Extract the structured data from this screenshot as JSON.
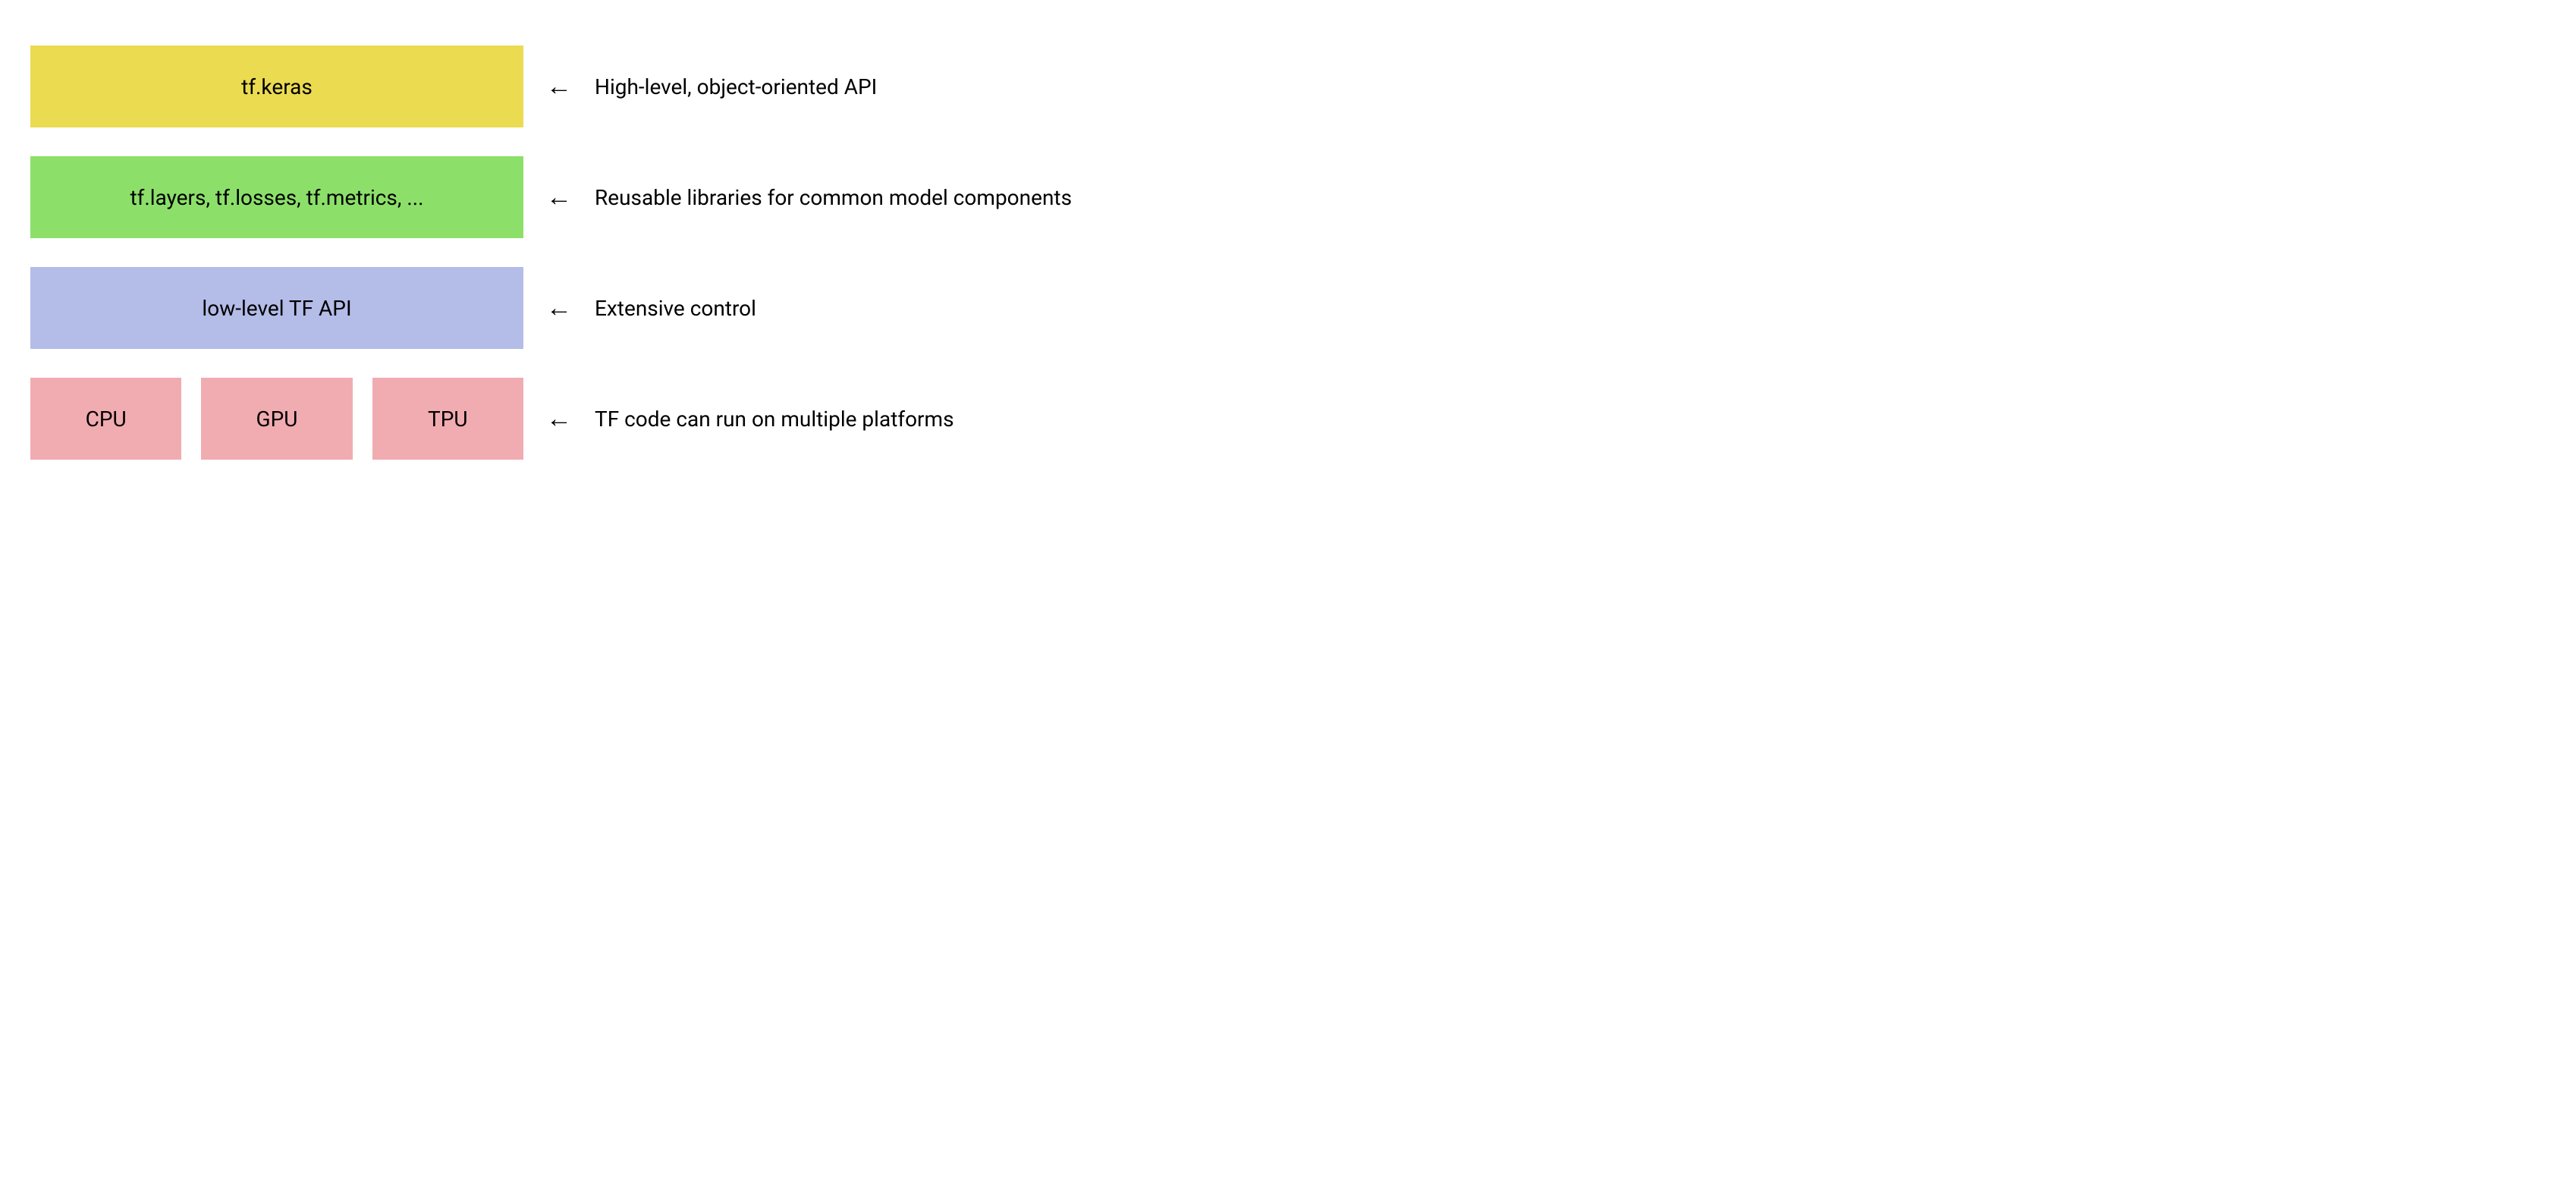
{
  "layers": [
    {
      "label": "tf.keras",
      "color": "yellow",
      "description": "High-level, object-oriented API"
    },
    {
      "label": "tf.layers, tf.losses, tf.metrics, ...",
      "color": "green",
      "description": "Reusable libraries for common model components"
    },
    {
      "label": "low-level TF API",
      "color": "blue",
      "description": "Extensive control"
    }
  ],
  "platforms": {
    "items": [
      "CPU",
      "GPU",
      "TPU"
    ],
    "color": "pink",
    "description": "TF code can run on multiple platforms"
  },
  "arrow_glyph": "←"
}
